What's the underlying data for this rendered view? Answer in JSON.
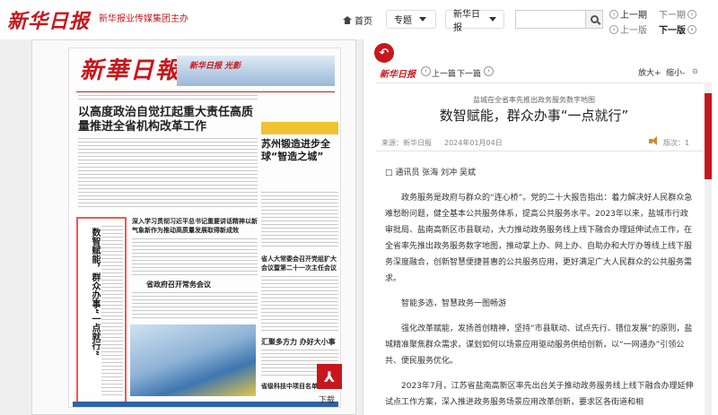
{
  "header": {
    "brand": "新华日报",
    "brand_sub": "新华报业传媒集团主办",
    "home": "首页",
    "topic": "专题",
    "paper": "新华日报",
    "search_placeholder": "",
    "prev_page": "上一期",
    "next_page": "下一期",
    "prev_issue": "上一版",
    "next_issue": "下一版"
  },
  "newspaper": {
    "masthead": "新華日報",
    "skyline_text": "新华日报 光影",
    "headline": "以高度政治自觉扛起重大责任高质量推进全省机构改革工作",
    "side_title": "苏州锻造进步全球“智造之城”",
    "mid_head": "深入学习贯彻习近平总书记重要讲话精神以新气象新作为推动高质量发展取得新成效",
    "right_head": "省人大常委会召开党组扩大会议暨第二十一次主任会议",
    "mid2": "省政府召开常务会议",
    "right2": "汇聚多方力 办好大小事",
    "right3": "省级科技中项目名单公示",
    "highlight": "数智赋能，群众办事“一点就行”",
    "download": "下载"
  },
  "article": {
    "logo": "新华日报",
    "prev": "上一篇",
    "next": "下一篇",
    "zoom_in": "放大+",
    "zoom_out": "缩小-",
    "kicker": "盐城在全省率先推出政务服务数字地图",
    "title": "数智赋能，群众办事“一点就行”",
    "source": "来源：新华日报",
    "date": "2024年01月04日",
    "edition": "版次：1",
    "byline": "□ 通讯员 张海 刘冲 吴斌",
    "paragraphs": [
      "政务服务是政府与群众的“连心桥”。党的二十大报告指出：着力解决好人民群众急难愁盼问题，健全基本公共服务体系，提高公共服务水平。2023年以来，盐城市行政审批局、盐南高新区市县联动，大力推动政务服务线上线下融合办理延伸试点工作，在全省率先推出政务服务数字地图，推动掌上办、网上办、自助办和大厅办等线上线下服务深度融合，创新智慧便捷普惠的公共服务应用，更好满足广大人民群众的公共服务需求。",
      "智能多选，智慧政务一图畅游",
      "强化改革赋能，发扬首创精神，坚持“市县联动、试点先行、错位发展”的原则，盐城精准聚焦群众需求，谋划如何以场景应用驱动服务供给创新，以“一网通办”引领公共、便民服务优化。",
      "2023年7月，江苏省盐南高新区率先出台关于推动政务服务线上线下融合办理延伸试点工作方案，深入推进政务服务场景应用改革创新，要求区各街道和相"
    ]
  }
}
